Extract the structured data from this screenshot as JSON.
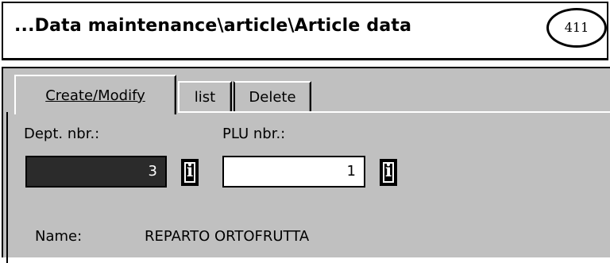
{
  "header": {
    "breadcrumb": "...Data maintenance\\article\\Article data",
    "screen_code": "411"
  },
  "tabs": [
    {
      "label": "Create/Modify",
      "active": true
    },
    {
      "label": "list",
      "active": false
    },
    {
      "label": "Delete",
      "active": false
    }
  ],
  "form": {
    "dept": {
      "label": "Dept. nbr.:",
      "value": "3"
    },
    "plu": {
      "label": "PLU nbr.:",
      "value": "1"
    },
    "info_icon_glyph": "i",
    "name": {
      "label": "Name:",
      "value": "REPARTO ORTOFRUTTA"
    }
  },
  "colors": {
    "panel_bg": "#c0c0c0",
    "dark_field_bg": "#2b2b2b",
    "light_field_bg": "#ffffff"
  }
}
